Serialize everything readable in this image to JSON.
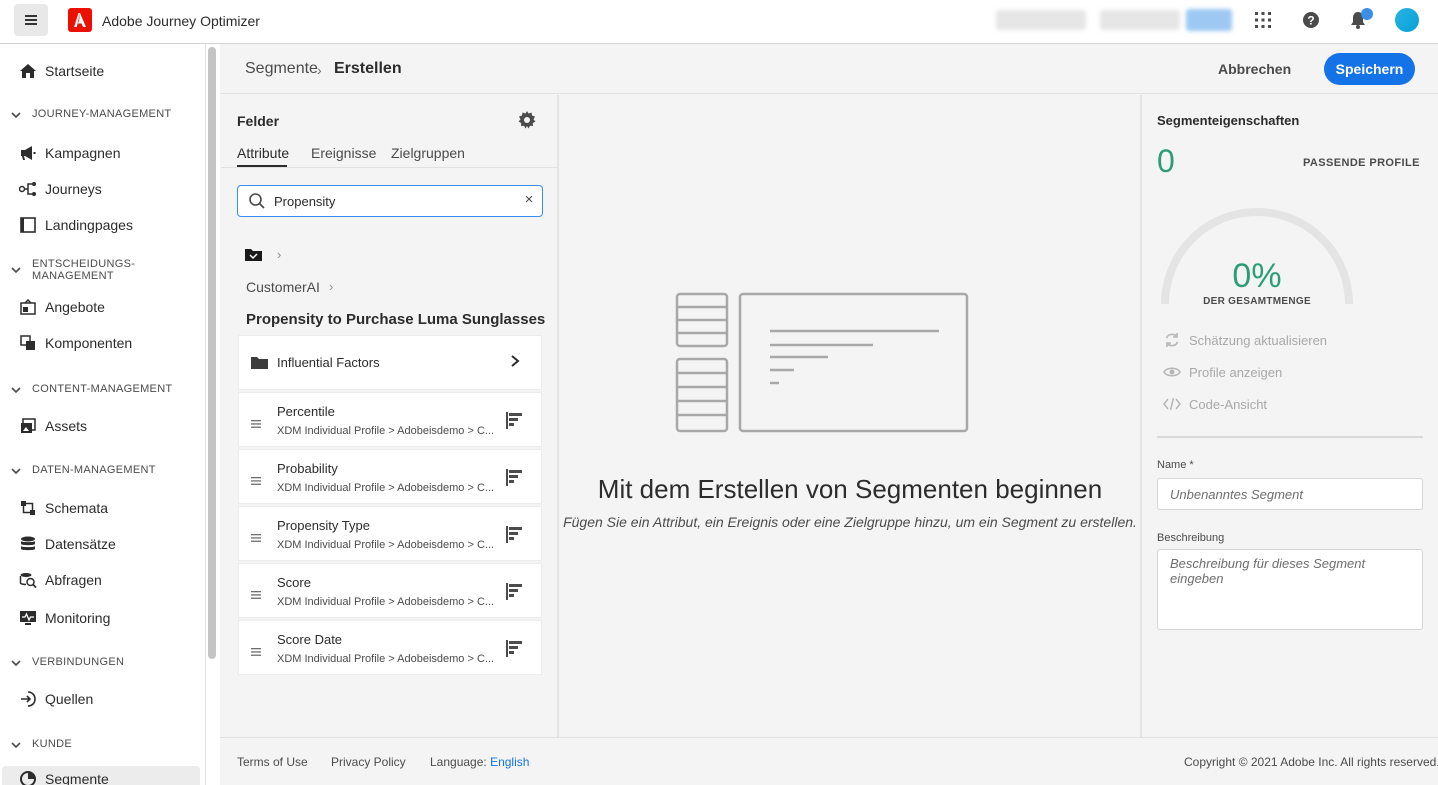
{
  "app": {
    "title": "Adobe Journey Optimizer"
  },
  "sidebar": {
    "home": "Startseite",
    "sections": {
      "journey": "JOURNEY-MANAGEMENT",
      "decision_line1": "ENTSCHEIDUNGS-",
      "decision_line2": "MANAGEMENT",
      "content": "CONTENT-MANAGEMENT",
      "data": "DATEN-MANAGEMENT",
      "connections": "VERBINDUNGEN",
      "customer": "KUNDE"
    },
    "items": {
      "campaigns": "Kampagnen",
      "journeys": "Journeys",
      "landingpages": "Landingpages",
      "offers": "Angebote",
      "components": "Komponenten",
      "assets": "Assets",
      "schemas": "Schemata",
      "datasets": "Datensätze",
      "queries": "Abfragen",
      "monitoring": "Monitoring",
      "sources": "Quellen",
      "segments": "Segmente"
    }
  },
  "header": {
    "breadcrumb_parent": "Segmente",
    "breadcrumb_current": "Erstellen",
    "cancel_label": "Abbrechen",
    "save_label": "Speichern"
  },
  "fields_panel": {
    "title": "Felder",
    "tabs": [
      "Attribute",
      "Ereignisse",
      "Zielgruppen"
    ],
    "search_value": "Propensity",
    "crumb": "CustomerAI",
    "group_title": "Propensity to Purchase Luma Sunglasses",
    "folder_item": "Influential Factors",
    "path_text": "XDM Individual Profile > Adobeisdemo > C...",
    "attributes": [
      {
        "name": "Percentile"
      },
      {
        "name": "Probability"
      },
      {
        "name": "Propensity Type"
      },
      {
        "name": "Score"
      },
      {
        "name": "Score Date"
      }
    ]
  },
  "canvas": {
    "title": "Mit dem Erstellen von Segmenten beginnen",
    "subtitle": "Fügen Sie ein Attribut, ein Ereignis oder eine Zielgruppe hinzu, um ein Segment zu erstellen."
  },
  "properties": {
    "title": "Segmenteigenschaften",
    "matching_count": "0",
    "matching_label": "PASSENDE PROFILE",
    "percent": "0%",
    "percent_label": "DER GESAMTMENGE",
    "percent_value": 0,
    "actions": {
      "refresh": "Schätzung aktualisieren",
      "view_profiles": "Profile anzeigen",
      "code_view": "Code-Ansicht"
    },
    "name_label": "Name *",
    "name_placeholder": "Unbenanntes Segment",
    "description_label": "Beschreibung",
    "description_placeholder": "Beschreibung für dieses Segment eingeben"
  },
  "footer": {
    "terms": "Terms of Use",
    "privacy": "Privacy Policy",
    "language_label": "Language:",
    "language_value": "English",
    "copyright": "Copyright ©  2021 Adobe Inc.  All rights reserved."
  },
  "colors": {
    "accent": "#1473e6",
    "success": "#2d9d78"
  }
}
